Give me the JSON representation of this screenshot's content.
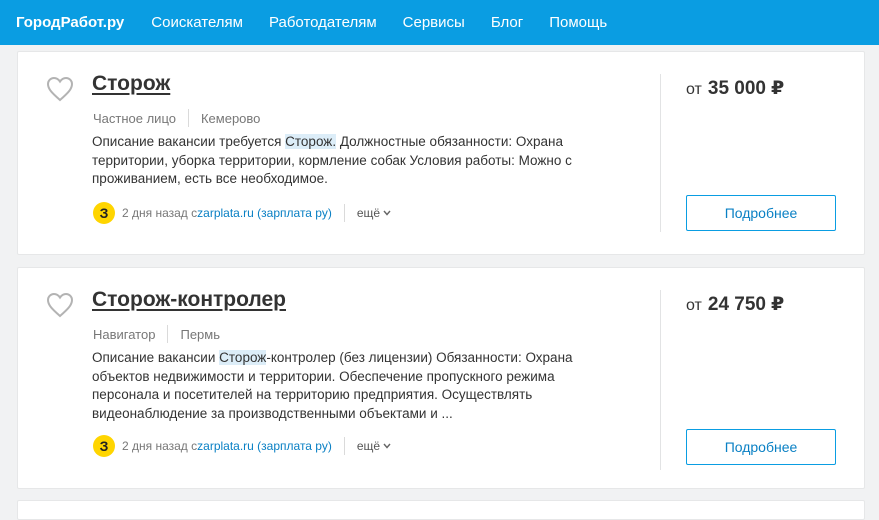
{
  "nav": {
    "logo": "ГородРабот.ру",
    "items": [
      "Соискателям",
      "Работодателям",
      "Сервисы",
      "Блог",
      "Помощь"
    ]
  },
  "vacancies": [
    {
      "title": "Сторож",
      "employer": "Частное лицо",
      "city": "Кемерово",
      "desc_before": "Описание вакансии требуется ",
      "desc_highlight": "Сторож.",
      "desc_after": " Должностные обязанности: Охрана территории, уборка территории, кормление собак Условия работы: Можно с проживанием, есть все необходимое.",
      "badge": "З",
      "posted": "2 дня назад с ",
      "source": "zarplata.ru (зарплата ру)",
      "more": "ещё",
      "salary_prefix": "от",
      "salary_amount": "35 000",
      "currency": "₽",
      "details_button": "Подробнее"
    },
    {
      "title": "Сторож-контролер",
      "employer": "Навигатор",
      "city": "Пермь",
      "desc_before": "Описание вакансии ",
      "desc_highlight": "Сторож",
      "desc_after": "-контролер (без лицензии) Обязанности: Охрана объектов недвижимости и территории. Обеспечение пропускного режима персонала и посетителей на территорию предприятия. Осуществлять видеонаблюдение за производственными объектами и ...",
      "badge": "З",
      "posted": "2 дня назад с ",
      "source": "zarplata.ru (зарплата ру)",
      "more": "ещё",
      "salary_prefix": "от",
      "salary_amount": "24 750",
      "currency": "₽",
      "details_button": "Подробнее"
    }
  ],
  "colors": {
    "header": "#0a9de2",
    "link": "#0a80c4",
    "badge": "#ffd500",
    "highlight": "#dcedf8"
  }
}
